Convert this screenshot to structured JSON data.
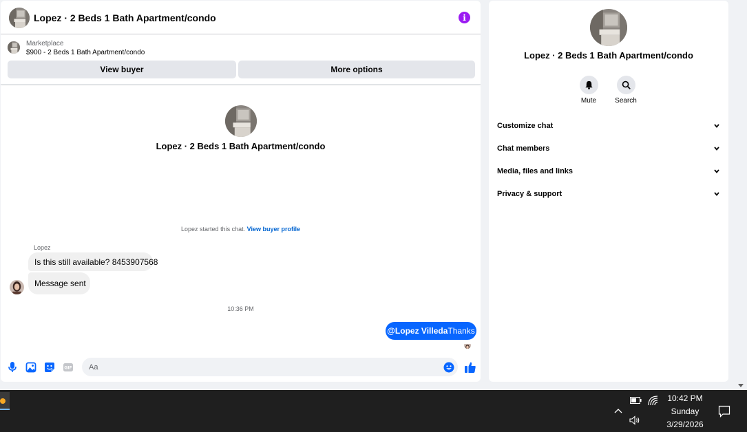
{
  "chat": {
    "title": "Lopez · 2 Beds 1 Bath Apartment/condo",
    "marketplace_label": "Marketplace",
    "listing": "$900 - 2 Beds 1 Bath Apartment/condo",
    "view_buyer_label": "View buyer",
    "more_options_label": "More options",
    "intro_title": "Lopez · 2 Beds 1 Bath Apartment/condo",
    "system_text": "Lopez started this chat.",
    "system_link": "View buyer profile",
    "sender_name": "Lopez",
    "messages_in": [
      "Is this still available? 8453907568",
      "Message sent"
    ],
    "timestamp": "10:36 PM",
    "message_out": {
      "mention": "@Lopez Villeda",
      "text": "Thanks"
    },
    "input_placeholder": "Aa"
  },
  "side": {
    "title": "Lopez · 2 Beds 1 Bath Apartment/condo",
    "actions": [
      {
        "label": "Mute",
        "icon": "bell-icon"
      },
      {
        "label": "Search",
        "icon": "search-icon"
      }
    ],
    "sections": [
      "Customize chat",
      "Chat members",
      "Media, files and links",
      "Privacy & support"
    ]
  },
  "taskbar": {
    "time": "10:42 PM",
    "day": "Sunday",
    "date": "3/29/2026"
  },
  "colors": {
    "accent_blue": "#0866ff",
    "info_purple": "#9b1bf2",
    "link_blue": "#0064d1",
    "taskbar": "#1f1f1f"
  }
}
